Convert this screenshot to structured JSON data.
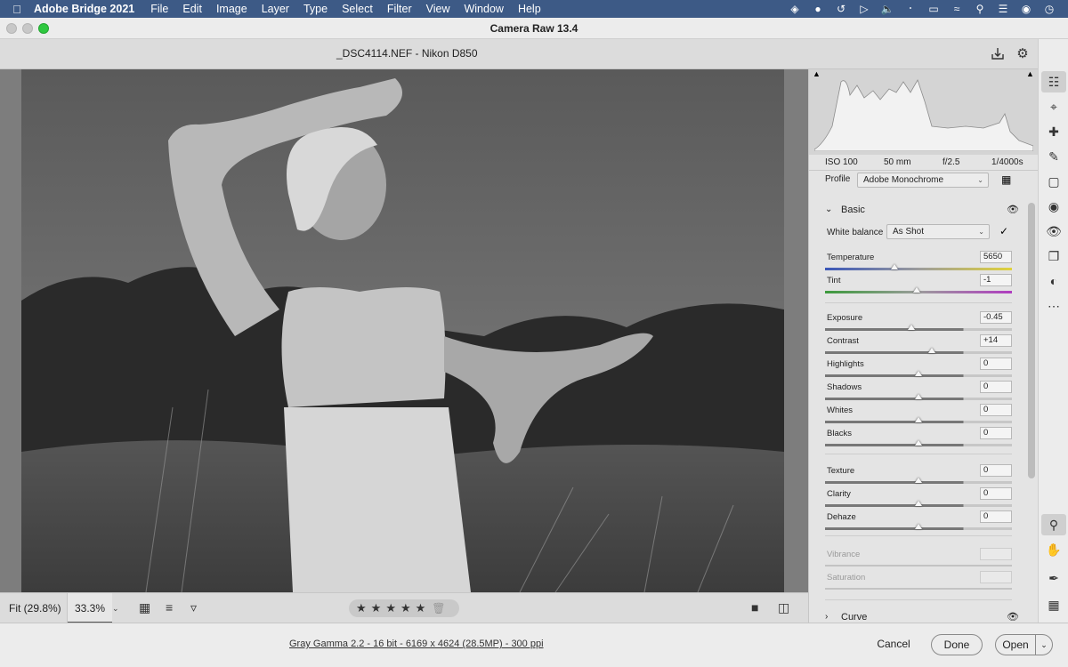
{
  "menubar": {
    "app_name": "Adobe Bridge 2021",
    "items": [
      "File",
      "Edit",
      "Image",
      "Layer",
      "Type",
      "Select",
      "Filter",
      "View",
      "Window",
      "Help"
    ]
  },
  "window": {
    "title": "Camera Raw 13.4"
  },
  "header": {
    "filename": "_DSC4114.NEF  -  Nikon D850"
  },
  "bottom_bar": {
    "zoom_fit": "Fit (29.8%)",
    "zoom_value": "33.3%",
    "rating_stars": 5
  },
  "footer": {
    "image_info": "Gray Gamma 2.2 - 16 bit - 6169 x 4624 (28.5MP) - 300 ppi",
    "cancel": "Cancel",
    "done": "Done",
    "open": "Open"
  },
  "exif": {
    "iso": "ISO 100",
    "focal": "50 mm",
    "aperture": "f/2.5",
    "shutter": "1/4000s"
  },
  "profile": {
    "label": "Profile",
    "value": "Adobe Monochrome"
  },
  "basic": {
    "title": "Basic",
    "wb_label": "White balance",
    "wb_value": "As Shot",
    "sliders": [
      {
        "label": "Temperature",
        "value": "5650",
        "level": 0.37
      },
      {
        "label": "Tint",
        "value": "-1",
        "level": 0.49
      },
      {
        "label": "Exposure",
        "value": "-0.45",
        "level": 0.46
      },
      {
        "label": "Contrast",
        "value": "+14",
        "level": 0.57
      },
      {
        "label": "Highlights",
        "value": "0",
        "level": 0.5
      },
      {
        "label": "Shadows",
        "value": "0",
        "level": 0.5
      },
      {
        "label": "Whites",
        "value": "0",
        "level": 0.5
      },
      {
        "label": "Blacks",
        "value": "0",
        "level": 0.5
      },
      {
        "label": "Texture",
        "value": "0",
        "level": 0.5
      },
      {
        "label": "Clarity",
        "value": "0",
        "level": 0.5
      },
      {
        "label": "Dehaze",
        "value": "0",
        "level": 0.5
      },
      {
        "label": "Vibrance",
        "value": "",
        "level": null
      },
      {
        "label": "Saturation",
        "value": "",
        "level": null
      }
    ]
  },
  "curve": {
    "title": "Curve"
  },
  "colors": {
    "menubar": "#3d5a86",
    "accent_green": "#2fc840"
  }
}
